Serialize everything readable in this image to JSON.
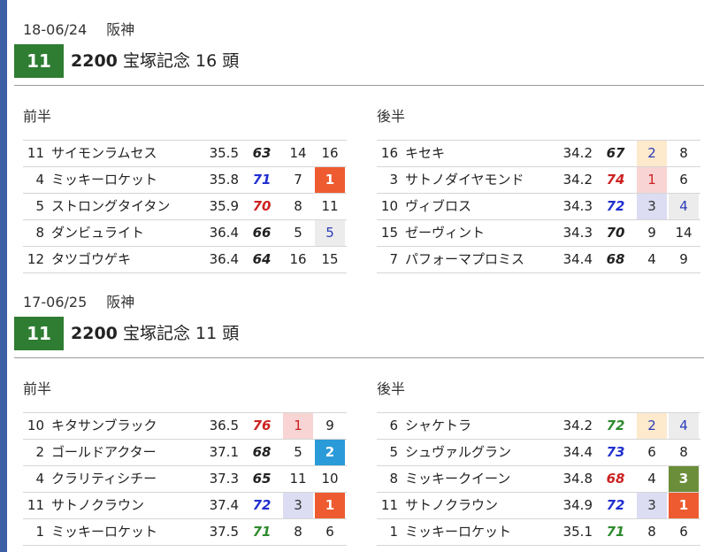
{
  "races": [
    {
      "date": "18-06/24",
      "venue": "阪神",
      "race_number": "11",
      "distance": "2200",
      "race_name": "宝塚記念",
      "runners": "16 頭",
      "first_half_label": "前半",
      "second_half_label": "後半",
      "first_half": [
        {
          "no": "11",
          "name": "サイモンラムセス",
          "time": "35.5",
          "index": "63",
          "index_color": "black",
          "p1": "14",
          "p1_style": "",
          "p2": "16",
          "p2_style": ""
        },
        {
          "no": "4",
          "name": "ミッキーロケット",
          "time": "35.8",
          "index": "71",
          "index_color": "blue",
          "p1": "7",
          "p1_style": "",
          "p2": "1",
          "p2_style": "bg-orange"
        },
        {
          "no": "5",
          "name": "ストロングタイタン",
          "time": "35.9",
          "index": "70",
          "index_color": "red",
          "p1": "8",
          "p1_style": "",
          "p2": "11",
          "p2_style": ""
        },
        {
          "no": "8",
          "name": "ダンビュライト",
          "time": "36.4",
          "index": "66",
          "index_color": "black",
          "p1": "5",
          "p1_style": "",
          "p2": "5",
          "p2_style": "bg-grey tcol-blue"
        },
        {
          "no": "12",
          "name": "タツゴウゲキ",
          "time": "36.4",
          "index": "64",
          "index_color": "black",
          "p1": "16",
          "p1_style": "",
          "p2": "15",
          "p2_style": ""
        }
      ],
      "second_half": [
        {
          "no": "16",
          "name": "キセキ",
          "time": "34.2",
          "index": "67",
          "index_color": "black",
          "p1": "2",
          "p1_style": "bg-peach tcol-blue",
          "p2": "8",
          "p2_style": ""
        },
        {
          "no": "3",
          "name": "サトノダイヤモンド",
          "time": "34.2",
          "index": "74",
          "index_color": "red",
          "p1": "1",
          "p1_style": "bg-pink tcol-red",
          "p2": "6",
          "p2_style": ""
        },
        {
          "no": "10",
          "name": "ヴィブロス",
          "time": "34.3",
          "index": "72",
          "index_color": "blue",
          "p1": "3",
          "p1_style": "bg-lav tcol-dark",
          "p2": "4",
          "p2_style": "bg-grey tcol-blue"
        },
        {
          "no": "15",
          "name": "ゼーヴィント",
          "time": "34.3",
          "index": "70",
          "index_color": "black",
          "p1": "9",
          "p1_style": "",
          "p2": "14",
          "p2_style": ""
        },
        {
          "no": "7",
          "name": "パフォーマプロミス",
          "time": "34.4",
          "index": "68",
          "index_color": "black",
          "p1": "4",
          "p1_style": "",
          "p2": "9",
          "p2_style": ""
        }
      ]
    },
    {
      "date": "17-06/25",
      "venue": "阪神",
      "race_number": "11",
      "distance": "2200",
      "race_name": "宝塚記念",
      "runners": "11 頭",
      "first_half_label": "前半",
      "second_half_label": "後半",
      "first_half": [
        {
          "no": "10",
          "name": "キタサンブラック",
          "time": "36.5",
          "index": "76",
          "index_color": "red",
          "p1": "1",
          "p1_style": "bg-pink tcol-red",
          "p2": "9",
          "p2_style": ""
        },
        {
          "no": "2",
          "name": "ゴールドアクター",
          "time": "37.1",
          "index": "68",
          "index_color": "black",
          "p1": "5",
          "p1_style": "",
          "p2": "2",
          "p2_style": "bg-blue"
        },
        {
          "no": "4",
          "name": "クラリティシチー",
          "time": "37.3",
          "index": "65",
          "index_color": "black",
          "p1": "11",
          "p1_style": "",
          "p2": "10",
          "p2_style": ""
        },
        {
          "no": "11",
          "name": "サトノクラウン",
          "time": "37.4",
          "index": "72",
          "index_color": "blue",
          "p1": "3",
          "p1_style": "bg-lav tcol-dark",
          "p2": "1",
          "p2_style": "bg-orange"
        },
        {
          "no": "1",
          "name": "ミッキーロケット",
          "time": "37.5",
          "index": "71",
          "index_color": "green",
          "p1": "8",
          "p1_style": "",
          "p2": "6",
          "p2_style": ""
        }
      ],
      "second_half": [
        {
          "no": "6",
          "name": "シャケトラ",
          "time": "34.2",
          "index": "72",
          "index_color": "green",
          "p1": "2",
          "p1_style": "bg-peach tcol-blue",
          "p2": "4",
          "p2_style": "bg-grey tcol-blue"
        },
        {
          "no": "5",
          "name": "シュヴァルグラン",
          "time": "34.4",
          "index": "73",
          "index_color": "blue",
          "p1": "6",
          "p1_style": "",
          "p2": "8",
          "p2_style": ""
        },
        {
          "no": "8",
          "name": "ミッキークイーン",
          "time": "34.8",
          "index": "68",
          "index_color": "red",
          "p1": "4",
          "p1_style": "",
          "p2": "3",
          "p2_style": "bg-green"
        },
        {
          "no": "11",
          "name": "サトノクラウン",
          "time": "34.9",
          "index": "72",
          "index_color": "blue",
          "p1": "3",
          "p1_style": "bg-lav tcol-dark",
          "p2": "1",
          "p2_style": "bg-orange"
        },
        {
          "no": "1",
          "name": "ミッキーロケット",
          "time": "35.1",
          "index": "71",
          "index_color": "green",
          "p1": "8",
          "p1_style": "",
          "p2": "6",
          "p2_style": ""
        }
      ]
    }
  ]
}
